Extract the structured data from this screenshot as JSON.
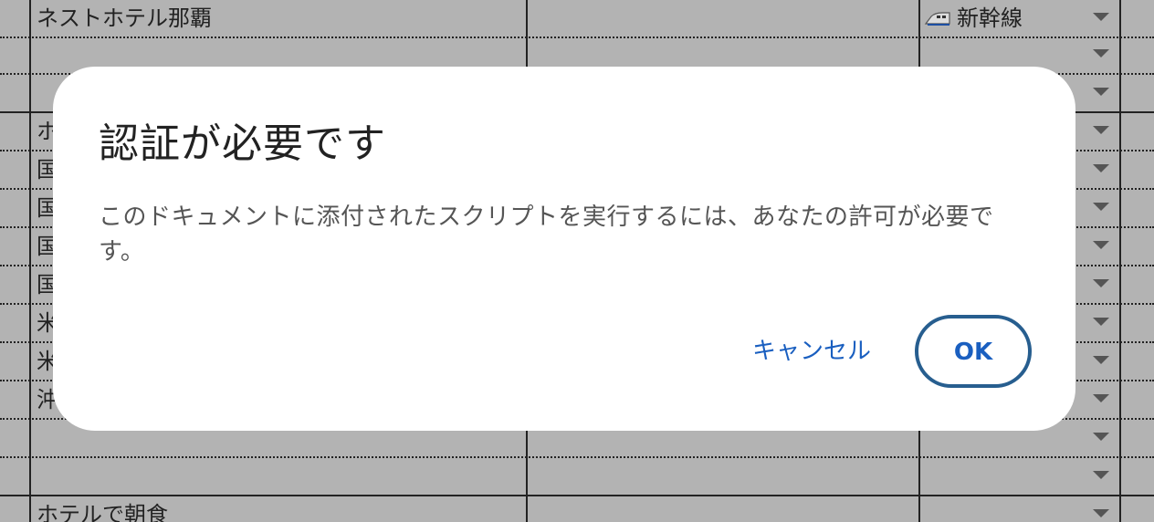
{
  "sheet": {
    "rows": [
      {
        "a": "ネストホテル那覇",
        "d": "新幹線",
        "d_icon": "shinkansen-train-icon"
      },
      {
        "a": "",
        "d": ""
      },
      {
        "a": "",
        "d": ""
      },
      {
        "a": "ホ",
        "d": ""
      },
      {
        "a": "国",
        "d": ""
      },
      {
        "a": "国",
        "d": ""
      },
      {
        "a": "国",
        "d": ""
      },
      {
        "a": "国",
        "d": ""
      },
      {
        "a": "米",
        "d": ""
      },
      {
        "a": "米",
        "d": ""
      },
      {
        "a": "沖",
        "d": ""
      },
      {
        "a": "",
        "d": ""
      },
      {
        "a": "",
        "d": ""
      },
      {
        "a": "ホテルで朝食",
        "d": ""
      }
    ]
  },
  "dialog": {
    "title": "認証が必要です",
    "message": "このドキュメントに添付されたスクリプトを実行するには、あなたの許可が必要です。",
    "cancel_label": "キャンセル",
    "ok_label": "OK"
  }
}
